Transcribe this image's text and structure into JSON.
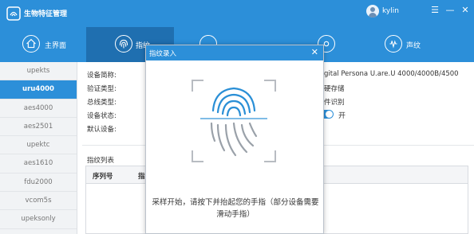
{
  "app": {
    "title": "生物特征管理",
    "username": "kylin",
    "colors": {
      "primary": "#2c8fd9",
      "active_tab": "#1f6fb0"
    }
  },
  "window_controls": [
    {
      "name": "menu-icon",
      "glyph": "☰"
    },
    {
      "name": "minimize-icon",
      "glyph": "—"
    },
    {
      "name": "close-icon",
      "glyph": "✕"
    }
  ],
  "nav": {
    "tabs": [
      {
        "label": "主界面",
        "icon": "home-icon"
      },
      {
        "label": "指纹",
        "icon": "fingerprint-icon"
      },
      {
        "label": "",
        "icon": "face-icon"
      },
      {
        "label": "",
        "icon": "iris-icon"
      },
      {
        "label": "声纹",
        "icon": "voiceprint-icon"
      }
    ]
  },
  "sidebar": {
    "items": [
      "upekts",
      "uru4000",
      "aes4000",
      "aes2501",
      "upektc",
      "aes1610",
      "fdu2000",
      "vcom5s",
      "upeksonly"
    ],
    "active_index": 1
  },
  "device_info": {
    "labels": [
      "设备简称:",
      "验证类型:",
      "总线类型:",
      "设备状态:",
      "默认设备:"
    ],
    "values": [
      "gital Persona U.are.U 4000/4000B/4500",
      "硬存储",
      "件识别"
    ],
    "toggle_state": "开",
    "toggle_on": true
  },
  "fingerprint_list": {
    "title": "指纹列表",
    "columns": [
      "序列号",
      "指"
    ]
  },
  "modal": {
    "title": "指纹录入",
    "close_glyph": "✕",
    "message": "采样开始，请按下并抬起您的手指（部分设备需要滑动手指）"
  }
}
